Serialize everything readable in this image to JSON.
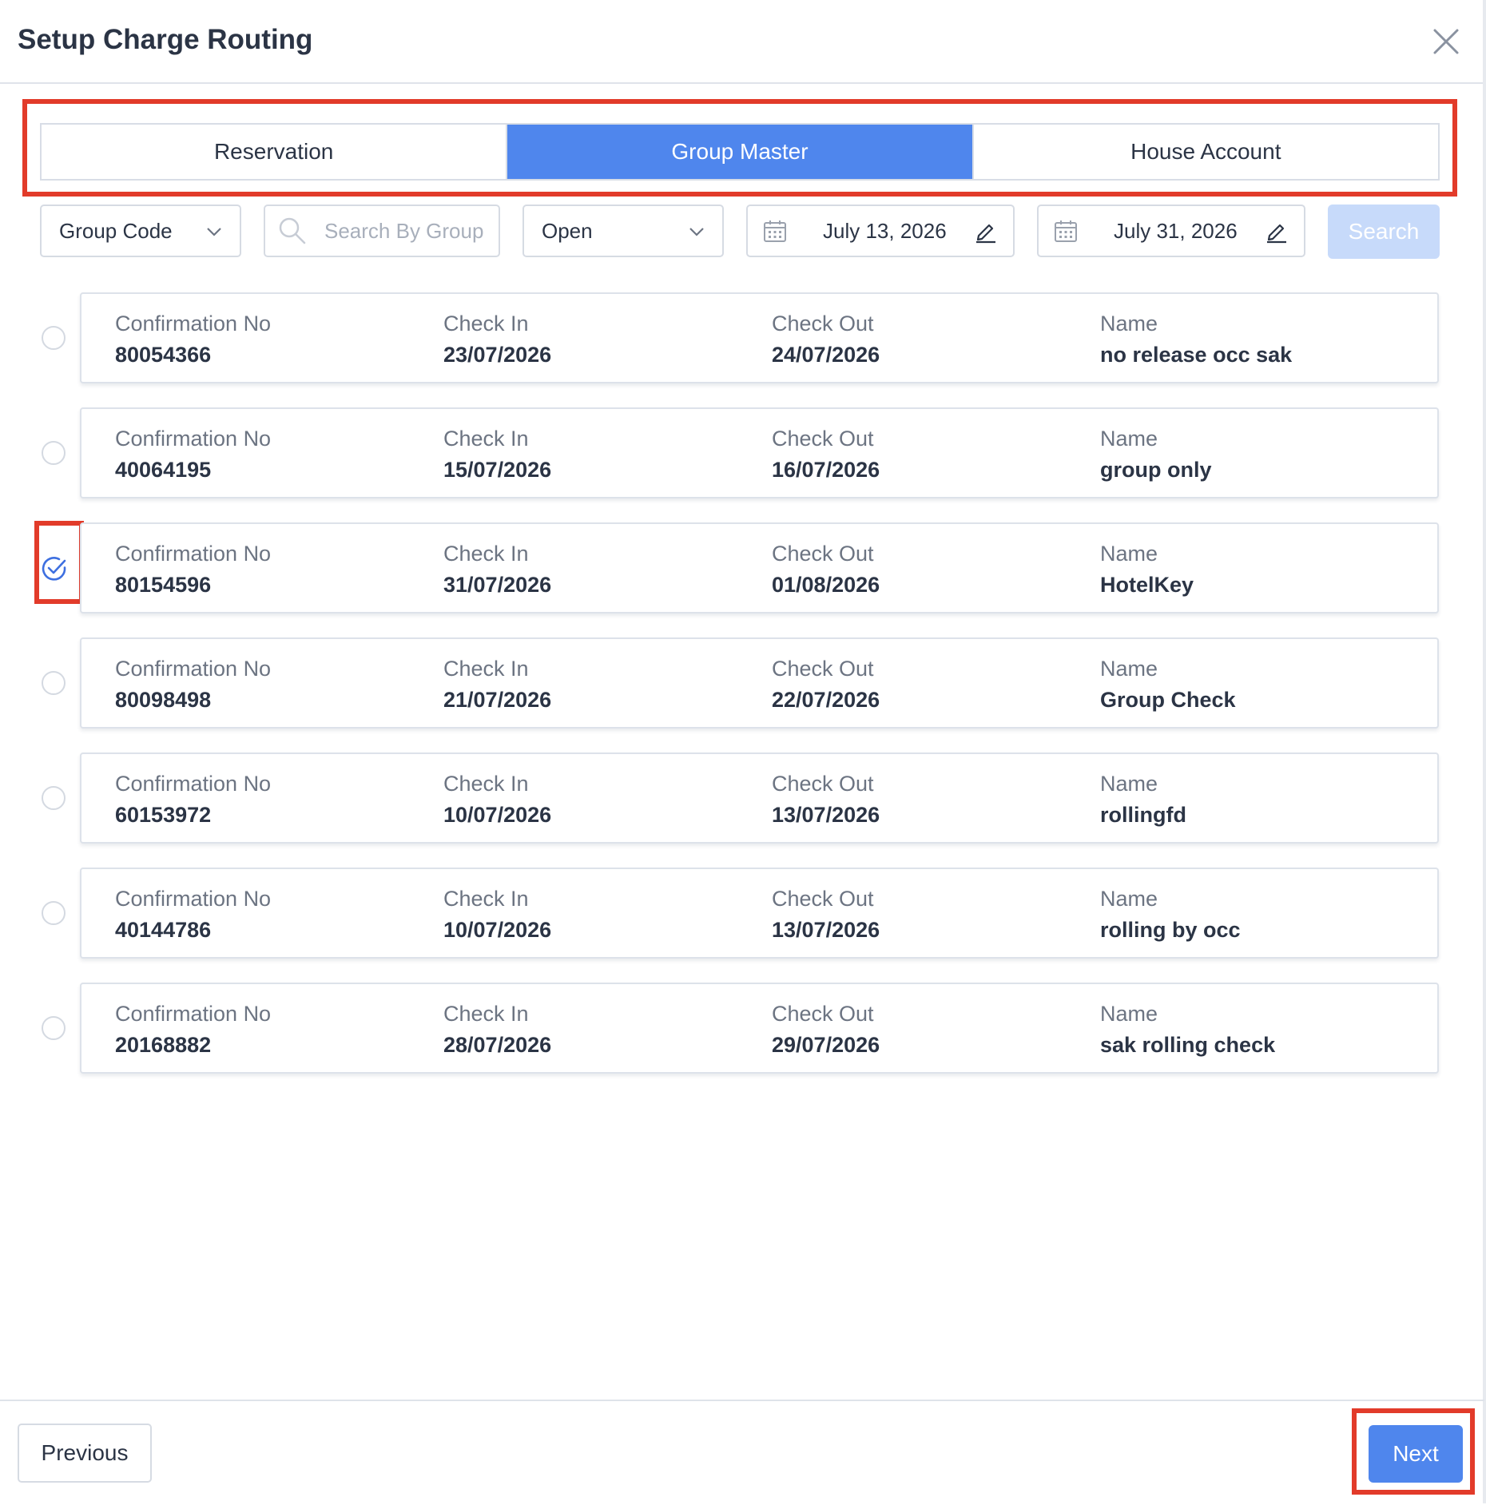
{
  "dialog": {
    "title": "Setup Charge Routing"
  },
  "tabs": [
    {
      "label": "Reservation",
      "active": false
    },
    {
      "label": "Group Master",
      "active": true
    },
    {
      "label": "House Account",
      "active": false
    }
  ],
  "filters": {
    "search_type": "Group Code",
    "search_placeholder": "Search By Group Code",
    "status": "Open",
    "from_date": "July 13, 2026",
    "to_date": "July 31, 2026",
    "search_label": "Search"
  },
  "field_labels": {
    "confirmation": "Confirmation No",
    "check_in": "Check In",
    "check_out": "Check Out",
    "name": "Name"
  },
  "rows": [
    {
      "confirmation": "80054366",
      "check_in": "23/07/2026",
      "check_out": "24/07/2026",
      "name": "no release occ sak",
      "selected": false
    },
    {
      "confirmation": "40064195",
      "check_in": "15/07/2026",
      "check_out": "16/07/2026",
      "name": "group only",
      "selected": false
    },
    {
      "confirmation": "80154596",
      "check_in": "31/07/2026",
      "check_out": "01/08/2026",
      "name": "HotelKey",
      "selected": true
    },
    {
      "confirmation": "80098498",
      "check_in": "21/07/2026",
      "check_out": "22/07/2026",
      "name": "Group Check",
      "selected": false
    },
    {
      "confirmation": "60153972",
      "check_in": "10/07/2026",
      "check_out": "13/07/2026",
      "name": "rollingfd",
      "selected": false
    },
    {
      "confirmation": "40144786",
      "check_in": "10/07/2026",
      "check_out": "13/07/2026",
      "name": "rolling by occ",
      "selected": false
    },
    {
      "confirmation": "20168882",
      "check_in": "28/07/2026",
      "check_out": "29/07/2026",
      "name": "sak rolling check",
      "selected": false
    }
  ],
  "footer": {
    "previous_label": "Previous",
    "next_label": "Next"
  },
  "colors": {
    "accent": "#4f86ed",
    "highlight": "#e23b2a",
    "search_disabled": "#c7dafa"
  },
  "icons": {
    "close": "close-icon",
    "chevron": "chevron-down-icon",
    "search": "search-icon",
    "calendar": "calendar-icon",
    "edit": "pencil-icon",
    "check": "check-circle-icon"
  }
}
